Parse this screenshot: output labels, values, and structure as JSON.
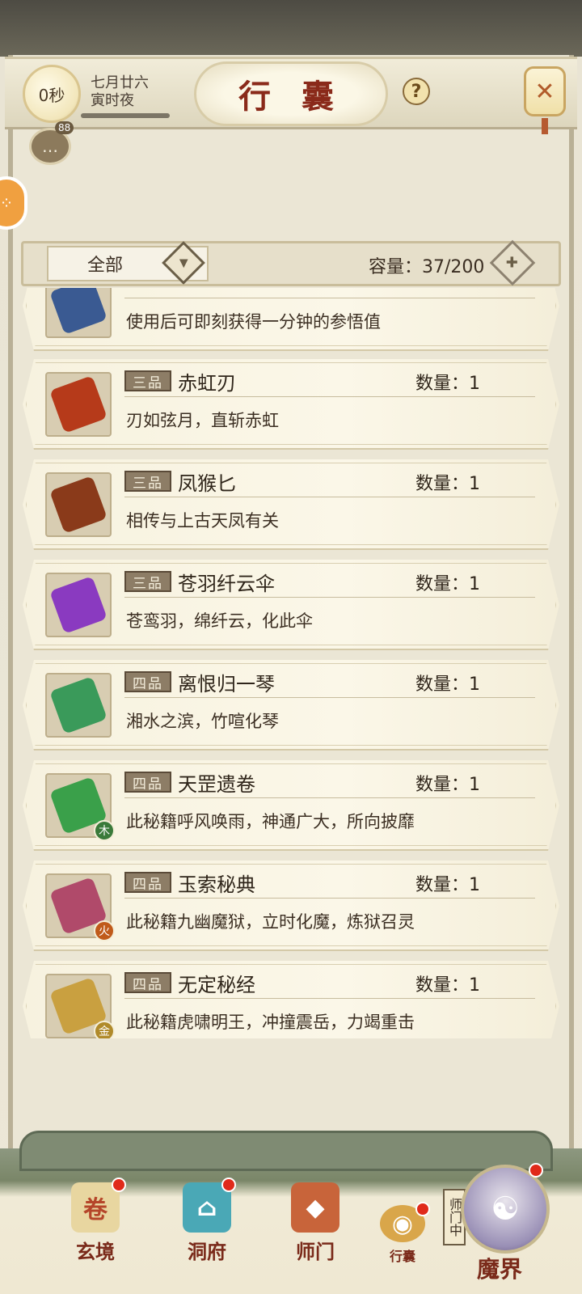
{
  "header": {
    "timer": "0秒",
    "date_line1": "七月廿六",
    "date_line2": "寅时夜",
    "title": "行 囊",
    "help": "?",
    "chat_badge": "88"
  },
  "filter": {
    "selected": "全部",
    "capacity": "容量：37/200"
  },
  "items": [
    {
      "grade": "",
      "name": "",
      "qty": "",
      "desc": "使用后可即刻获得一分钟的参悟值",
      "element": "",
      "icon": "book-icon",
      "color": "#3a5a92"
    },
    {
      "grade": "三品",
      "name": "赤虹刃",
      "qty": "数量：1",
      "desc": "刃如弦月，直斩赤虹",
      "element": "",
      "icon": "blade-icon",
      "color": "#b63a1a"
    },
    {
      "grade": "三品",
      "name": "凤猴匕",
      "qty": "数量：1",
      "desc": "相传与上古天凤有关",
      "element": "",
      "icon": "dagger-icon",
      "color": "#8a3a1a"
    },
    {
      "grade": "三品",
      "name": "苍羽纤云伞",
      "qty": "数量：1",
      "desc": "苍鸾羽，绵纤云，化此伞",
      "element": "",
      "icon": "umbrella-icon",
      "color": "#8a3ac0"
    },
    {
      "grade": "四品",
      "name": "离恨归一琴",
      "qty": "数量：1",
      "desc": "湘水之滨，竹喧化琴",
      "element": "",
      "icon": "zither-icon",
      "color": "#3a9a5a"
    },
    {
      "grade": "四品",
      "name": "天罡遗卷",
      "qty": "数量：1",
      "desc": "此秘籍呼风唤雨，神通广大，所向披靡",
      "element": "木",
      "elementColor": "#3a7a3a",
      "icon": "scroll-icon",
      "color": "#3aa04a"
    },
    {
      "grade": "四品",
      "name": "玉索秘典",
      "qty": "数量：1",
      "desc": "此秘籍九幽魔狱，立时化魔，炼狱召灵",
      "element": "火",
      "elementColor": "#c05a1a",
      "icon": "tome-icon",
      "color": "#b04a6a"
    },
    {
      "grade": "四品",
      "name": "无定秘经",
      "qty": "数量：1",
      "desc": "此秘籍虎啸明王，冲撞震岳，力竭重击",
      "element": "金",
      "elementColor": "#b08a2a",
      "icon": "tome-icon",
      "color": "#c9a040"
    }
  ],
  "nav": {
    "xuanjing": "玄境",
    "dongfu": "洞府",
    "shimen": "师门",
    "xingnang": "行囊",
    "mojie": "魔界",
    "shimen_tag": "师门中"
  }
}
